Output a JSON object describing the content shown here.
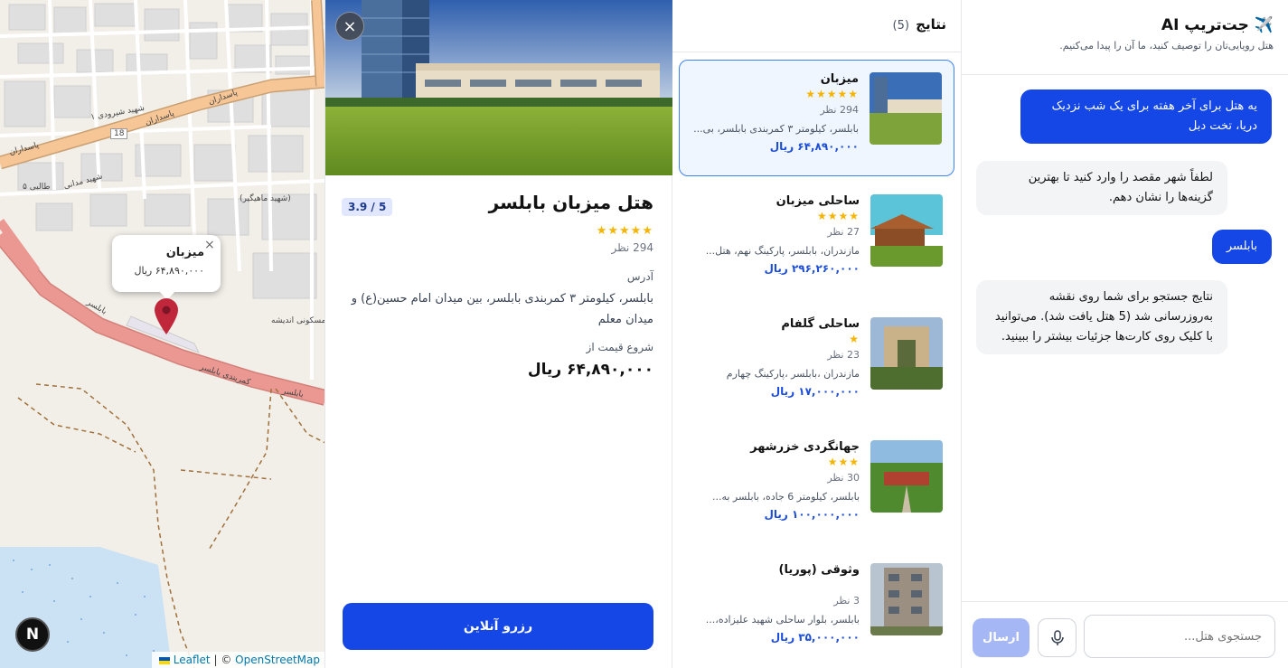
{
  "map": {
    "popup": {
      "title": "میزبان",
      "price": "۶۴,۸۹۰,۰۰۰ ریال",
      "close": "×"
    },
    "labels": {
      "road_pasdaran_1": "پاسداران",
      "road_pasdaran_2": "پاسداران",
      "road_pasdaran_3": "پاسداران",
      "road_18": "18",
      "road_madani": "شهید مدانی",
      "road_kamarbandi": "کمربندی بابلسر",
      "road_babol": "بابلسر",
      "park": "پارک مسکونی اندیشه",
      "mahigir": "(شهید ماهیگیر)",
      "talebi": "طالبی ۵",
      "shohada": "شهید شیرودی ۱"
    },
    "attribution": {
      "leaflet": "Leaflet",
      "sep": "| ©",
      "osm": "OpenStreetMap"
    },
    "n_badge": "N"
  },
  "detail": {
    "close": "×",
    "title": "هتل میزبان بابلسر",
    "rating": "3.9 / 5",
    "stars": "★★★★★",
    "reviews": "294 نظر",
    "address_label": "آدرس",
    "address": "بابلسر، کیلومتر ۳ کمربندی بابلسر، بین میدان امام حسین(ع) و میدان معلم",
    "price_label": "شروع قیمت از",
    "price": "۶۴,۸۹۰,۰۰۰ ریال",
    "book_label": "رزرو آنلاین"
  },
  "results": {
    "title": "نتایج",
    "count": "(5)",
    "items": [
      {
        "name": "میزبان",
        "stars": "★★★★★",
        "reviews": "294 نظر",
        "address": "بابلسر، کیلومتر ۳ کمربندی بابلسر، بی...",
        "price": "۶۴,۸۹۰,۰۰۰ ریال"
      },
      {
        "name": "ساحلی میزبان",
        "stars": "★★★★",
        "reviews": "27 نظر",
        "address": "مازندران، بابلسر، پارکینگ نهم، هتل...",
        "price": "۲۹۶,۲۶۰,۰۰۰ ریال"
      },
      {
        "name": "ساحلی گلفام",
        "stars": "★",
        "reviews": "23 نظر",
        "address": "مازندران ،بابلسر ،پارکینگ چهارم",
        "price": "۱۷,۰۰۰,۰۰۰ ریال"
      },
      {
        "name": "جهانگردی خزرشهر",
        "stars": "★★★",
        "reviews": "30 نظر",
        "address": "بابلسر، کیلومتر 6 جاده، بابلسر به...",
        "price": "۱۰۰,۰۰۰,۰۰۰ ریال"
      },
      {
        "name": "وثوقی (پوریا)",
        "stars": "",
        "reviews": "3 نظر",
        "address": "بابلسر، بلوار ساحلی شهید علیزاده،...",
        "price": "۳۵,۰۰۰,۰۰۰ ریال"
      }
    ]
  },
  "chat": {
    "title": "جت‌تریپ AI",
    "plane_icon": "✈️",
    "subtitle": "هتل رویایی‌تان را توصیف کنید، ما آن را پیدا می‌کنیم.",
    "messages": [
      {
        "role": "user",
        "text": "یه هتل برای آخر هفته برای یک شب نزدیک دریا، تخت دبل"
      },
      {
        "role": "bot",
        "text": "لطفاً شهر مقصد را وارد کنید تا بهترین گزینه‌ها را نشان دهم."
      },
      {
        "role": "user",
        "text": "بابلسر"
      },
      {
        "role": "bot",
        "text": "نتایج جستجو برای شما روی نقشه به‌روزرسانی شد (5 هتل یافت شد). می‌توانید با کلیک روی کارت‌ها جزئیات بیشتر را ببینید."
      }
    ],
    "input_placeholder": "جستجوی هتل...",
    "send_label": "ارسال"
  }
}
